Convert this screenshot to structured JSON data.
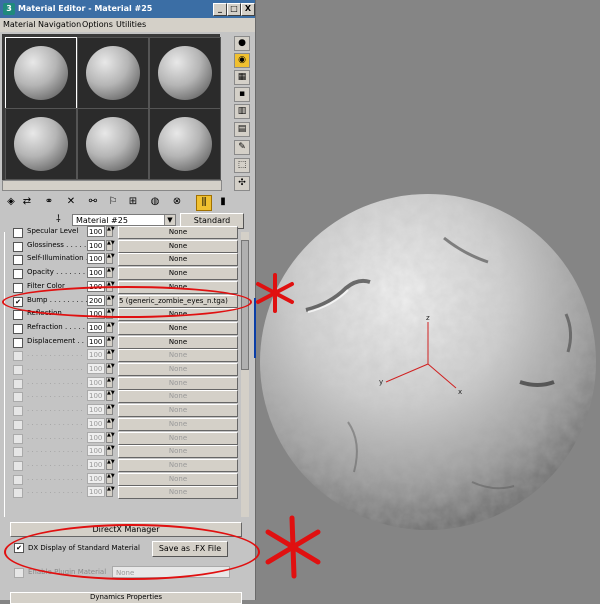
{
  "window": {
    "title": "Material Editor - Material #25",
    "app_icon": "3",
    "buttons": {
      "minimize": "_",
      "maximize": "□",
      "close": "X"
    }
  },
  "menu": [
    "Material",
    "Navigation",
    "Options",
    "Utilities"
  ],
  "sample_slots": {
    "count": 6,
    "selected_index": 0
  },
  "side_tools": [
    "sample-type-icon",
    "backlight-icon",
    "background-icon",
    "uv-tiling-icon",
    "video-color-check-icon",
    "make-preview-icon",
    "options-icon",
    "select-by-material-icon",
    "material-navigator-icon"
  ],
  "toolbar_icons": [
    "get-material-icon",
    "put-to-scene-icon",
    "assign-material-icon",
    "reset-map-icon",
    "make-unique-icon",
    "put-to-library-icon",
    "material-effects-channel-icon",
    "show-map-in-viewport-icon",
    "show-end-result-icon",
    "go-to-parent-icon",
    "go-forward-to-sibling-icon"
  ],
  "material": {
    "name": "Material #25",
    "type_button": "Standard"
  },
  "maps": [
    {
      "label": "Specular Level",
      "checked": false,
      "amount": "100",
      "map": "None",
      "dim": false
    },
    {
      "label": "Glossiness . . . . . .",
      "checked": false,
      "amount": "100",
      "map": "None",
      "dim": false
    },
    {
      "label": "Self-Illumination . .",
      "checked": false,
      "amount": "100",
      "map": "None",
      "dim": false
    },
    {
      "label": "Opacity . . . . . . . .",
      "checked": false,
      "amount": "100",
      "map": "None",
      "dim": false
    },
    {
      "label": "Filter Color",
      "checked": false,
      "amount": "100",
      "map": "None",
      "dim": false
    },
    {
      "label": "Bump . . . . . . . . .",
      "checked": true,
      "amount": "200",
      "map": "5 (generic_zombie_eyes_n.tga)",
      "dim": false
    },
    {
      "label": "Reflection",
      "checked": false,
      "amount": "100",
      "map": "None",
      "dim": false
    },
    {
      "label": "Refraction . . . . . .",
      "checked": false,
      "amount": "100",
      "map": "None",
      "dim": false
    },
    {
      "label": "Displacement . . .",
      "checked": false,
      "amount": "100",
      "map": "None",
      "dim": false
    },
    {
      "label": ". . . . . . . . . . . . .",
      "checked": false,
      "amount": "100",
      "map": "None",
      "dim": true
    },
    {
      "label": ". . . . . . . . . . . . .",
      "checked": false,
      "amount": "100",
      "map": "None",
      "dim": true
    },
    {
      "label": ". . . . . . . . . . . . .",
      "checked": false,
      "amount": "100",
      "map": "None",
      "dim": true
    },
    {
      "label": ". . . . . . . . . . . . .",
      "checked": false,
      "amount": "100",
      "map": "None",
      "dim": true
    },
    {
      "label": ". . . . . . . . . . . . .",
      "checked": false,
      "amount": "100",
      "map": "None",
      "dim": true
    },
    {
      "label": ". . . . . . . . . . . . .",
      "checked": false,
      "amount": "100",
      "map": "None",
      "dim": true
    },
    {
      "label": ". . . . . . . . . . . . .",
      "checked": false,
      "amount": "100",
      "map": "None",
      "dim": true
    },
    {
      "label": ". . . . . . . . . . . . .",
      "checked": false,
      "amount": "100",
      "map": "None",
      "dim": true
    },
    {
      "label": ". . . . . . . . . . . . .",
      "checked": false,
      "amount": "100",
      "map": "None",
      "dim": true
    },
    {
      "label": ". . . . . . . . . . . . .",
      "checked": false,
      "amount": "100",
      "map": "None",
      "dim": true
    },
    {
      "label": ". . . . . . . . . . . . .",
      "checked": false,
      "amount": "100",
      "map": "None",
      "dim": true
    }
  ],
  "directx": {
    "section_title": "DirectX Manager",
    "dx_display_label": "DX Display of Standard Material",
    "dx_display_checked": true,
    "save_button": "Save as .FX File",
    "plugin_label": "Enable Plugin Material",
    "plugin_select": "None",
    "next_rollout": "Dynamics Properties"
  },
  "viewport": {
    "axis_labels": {
      "z": "z",
      "x": "x",
      "y": "y"
    }
  },
  "colors": {
    "title_bar": "#3b6ea5",
    "annotation": "#e01010",
    "viewport_bg": "#858585"
  }
}
